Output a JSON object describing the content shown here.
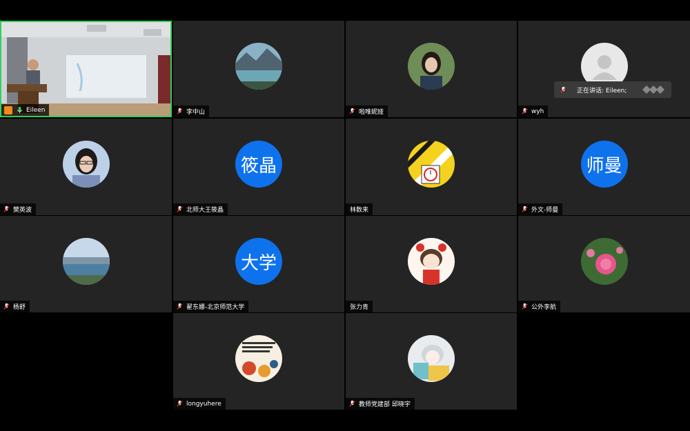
{
  "colors": {
    "background": "#000000",
    "tile": "#242424",
    "active_border": "#2ed15b",
    "avatar_blue": "#0e72ed",
    "mic_muted": "#e02828"
  },
  "speaking_popup": {
    "text": "正在讲话: Eileen;"
  },
  "participants": [
    {
      "name": "Eileen",
      "mic": "active",
      "video": "on",
      "avatar": "stage-video"
    },
    {
      "name": "李中山",
      "mic": "muted",
      "avatar": "lake-mountain-photo"
    },
    {
      "name": "啦唯妮娅",
      "mic": "muted",
      "avatar": "woman-portrait-photo"
    },
    {
      "name": "wyh",
      "mic": "muted",
      "avatar": "default-person-icon"
    },
    {
      "name": "樊英波",
      "mic": "muted",
      "avatar": "woman-glasses-photo"
    },
    {
      "name": "北师大王筱晶",
      "mic": "muted",
      "avatar_text": "筱晶"
    },
    {
      "name": "林数来",
      "mic": "none",
      "avatar": "math-tools-illustration"
    },
    {
      "name": "外文-师曼",
      "mic": "muted",
      "avatar_text": "师曼"
    },
    {
      "name": "杨舒",
      "mic": "muted",
      "avatar": "lake-landscape-photo"
    },
    {
      "name": "翟东娜-北京师范大学",
      "mic": "muted",
      "avatar_text": "大学"
    },
    {
      "name": "张力青",
      "mic": "none",
      "avatar": "cartoon-girl-illustration"
    },
    {
      "name": "公外李航",
      "mic": "muted",
      "avatar": "peony-flower-photo"
    },
    {
      "name": "longyuhere",
      "mic": "muted",
      "avatar": "book-cover-art"
    },
    {
      "name": "教师党建部 邱晓宇",
      "mic": "muted",
      "avatar": "anime-illustration"
    }
  ]
}
